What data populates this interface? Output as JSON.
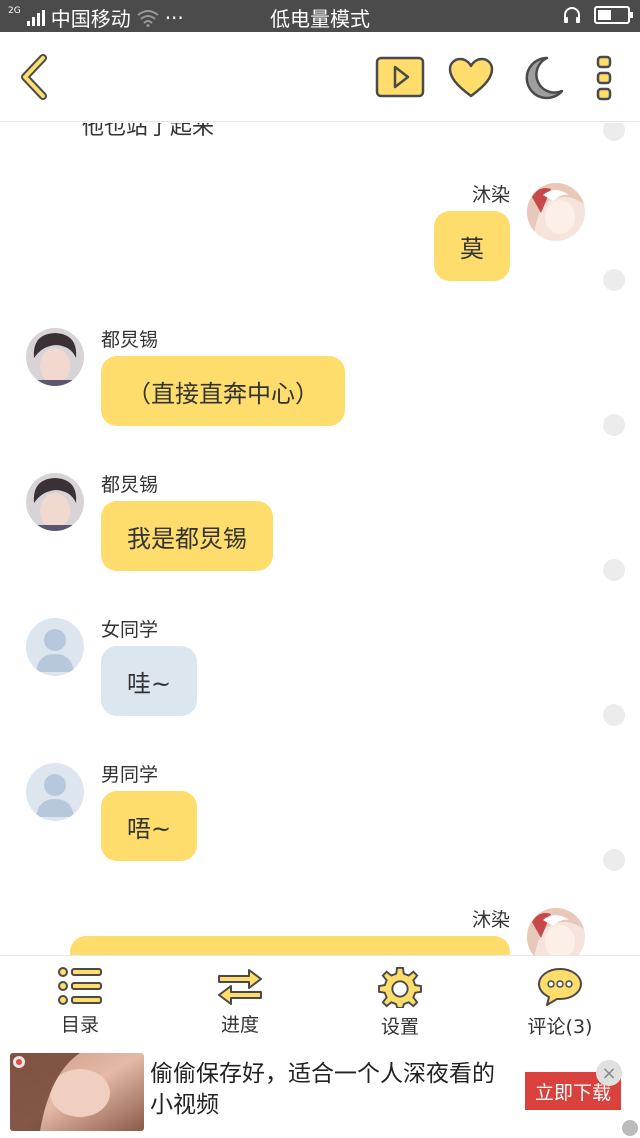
{
  "status_bar": {
    "network": "2G",
    "carrier": "中国移动",
    "more": "···",
    "mode": "低电量模式",
    "battery_level": 0.45
  },
  "toolbar": {
    "back_icon": "chevron-left-icon",
    "icons": [
      "play-icon",
      "heart-icon",
      "moon-icon",
      "more-vertical-icon"
    ],
    "accent": "#fedd6c"
  },
  "chat": {
    "top_fragment": "他也站了起来",
    "messages": [
      {
        "sender": "沐染",
        "text": "莫",
        "side": "right",
        "style": "yellow"
      },
      {
        "sender": "都炅锡",
        "text": "（直接直奔中心）",
        "side": "left",
        "style": "yellow"
      },
      {
        "sender": "都炅锡",
        "text": "我是都炅锡",
        "side": "left",
        "style": "yellow"
      },
      {
        "sender": "女同学",
        "text": "哇~",
        "side": "left",
        "style": "gray"
      },
      {
        "sender": "男同学",
        "text": "唔~",
        "side": "left",
        "style": "gray"
      },
      {
        "sender": "沐染",
        "text": "",
        "side": "right",
        "style": "yellow"
      }
    ]
  },
  "bottom_nav": [
    {
      "label": "目录",
      "icon": "list-icon"
    },
    {
      "label": "进度",
      "icon": "swap-arrows-icon"
    },
    {
      "label": "设置",
      "icon": "gear-icon"
    },
    {
      "label": "评论(3)",
      "icon": "comment-icon"
    }
  ],
  "ad": {
    "text": "偷偷保存好，适合一个人深夜看的小视频",
    "button": "立即下载",
    "close": "×"
  }
}
